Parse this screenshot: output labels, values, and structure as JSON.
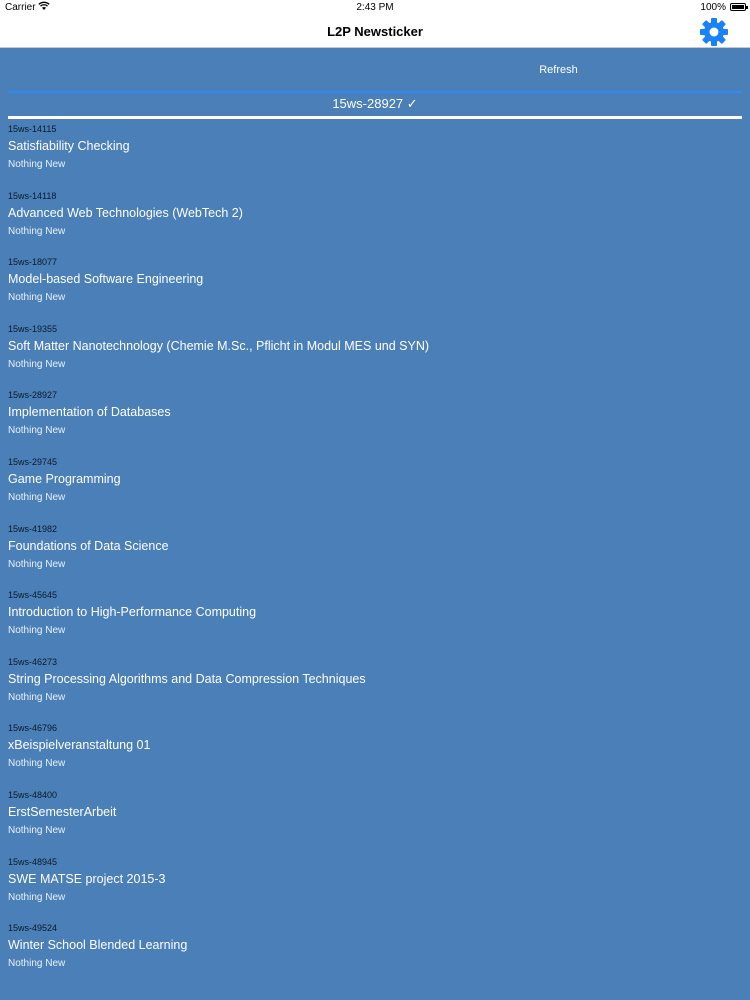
{
  "status_bar": {
    "carrier": "Carrier",
    "wifi_icon": "wifi-icon",
    "time": "2:43 PM",
    "battery_pct": "100%",
    "battery_icon": "battery-icon"
  },
  "nav": {
    "title": "L2P Newsticker",
    "settings_icon": "gear-icon",
    "accent": "#1a82f7"
  },
  "tabs": {
    "left_label": "",
    "right_label": "Refresh"
  },
  "filter": {
    "label": "15ws-28927 ✓"
  },
  "colors": {
    "background": "#4a7fb8",
    "tab_underline": "#2f8cf0"
  },
  "courses": [
    {
      "code": "15ws-14115",
      "name": "Satisfiability Checking",
      "status": "Nothing New"
    },
    {
      "code": "15ws-14118",
      "name": "Advanced Web Technologies (WebTech 2)",
      "status": "Nothing New"
    },
    {
      "code": "15ws-18077",
      "name": "Model-based Software Engineering",
      "status": "Nothing New"
    },
    {
      "code": "15ws-19355",
      "name": "Soft Matter Nanotechnology (Chemie M.Sc., Pflicht in Modul MES und SYN)",
      "status": "Nothing New"
    },
    {
      "code": "15ws-28927",
      "name": "Implementation of Databases",
      "status": "Nothing New"
    },
    {
      "code": "15ws-29745",
      "name": "Game Programming",
      "status": "Nothing New"
    },
    {
      "code": "15ws-41982",
      "name": "Foundations of Data Science",
      "status": "Nothing New"
    },
    {
      "code": "15ws-45645",
      "name": "Introduction to High-Performance Computing",
      "status": "Nothing New"
    },
    {
      "code": "15ws-46273",
      "name": "String Processing Algorithms and Data Compression Techniques",
      "status": "Nothing New"
    },
    {
      "code": "15ws-46796",
      "name": "xBeispielveranstaltung 01",
      "status": "Nothing New"
    },
    {
      "code": "15ws-48400",
      "name": "ErstSemesterArbeit",
      "status": "Nothing New"
    },
    {
      "code": "15ws-48945",
      "name": "SWE MATSE project 2015-3",
      "status": "Nothing New"
    },
    {
      "code": "15ws-49524",
      "name": "Winter School Blended Learning",
      "status": "Nothing New"
    }
  ]
}
